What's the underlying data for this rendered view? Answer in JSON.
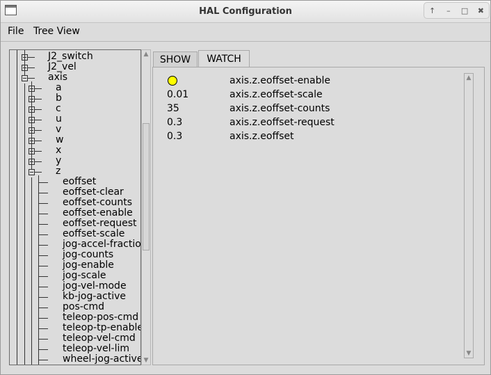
{
  "window": {
    "title": "HAL Configuration",
    "buttons": {
      "up": "↑",
      "minimize": "–",
      "maximize": "□",
      "close": "✖"
    }
  },
  "menu": {
    "file": "File",
    "tree_view": "Tree View"
  },
  "tree": {
    "top_items": [
      {
        "label": "J2_switch",
        "expander": "plus"
      },
      {
        "label": "J2_vel",
        "expander": "plus"
      },
      {
        "label": "axis",
        "expander": "minus"
      }
    ],
    "axis_children": [
      {
        "label": "a",
        "expander": "plus"
      },
      {
        "label": "b",
        "expander": "plus"
      },
      {
        "label": "c",
        "expander": "plus"
      },
      {
        "label": "u",
        "expander": "plus"
      },
      {
        "label": "v",
        "expander": "plus"
      },
      {
        "label": "w",
        "expander": "plus"
      },
      {
        "label": "x",
        "expander": "plus"
      },
      {
        "label": "y",
        "expander": "plus"
      },
      {
        "label": "z",
        "expander": "minus"
      }
    ],
    "z_children": [
      "eoffset",
      "eoffset-clear",
      "eoffset-counts",
      "eoffset-enable",
      "eoffset-request",
      "eoffset-scale",
      "jog-accel-fraction",
      "jog-counts",
      "jog-enable",
      "jog-scale",
      "jog-vel-mode",
      "kb-jog-active",
      "pos-cmd",
      "teleop-pos-cmd",
      "teleop-tp-enable",
      "teleop-vel-cmd",
      "teleop-vel-lim",
      "wheel-jog-active"
    ]
  },
  "tabs": {
    "show": "SHOW",
    "watch": "WATCH",
    "active": "watch"
  },
  "watch": {
    "led_color": "#ffff00",
    "rows": [
      {
        "value": "",
        "kind": "led",
        "name": "axis.z.eoffset-enable"
      },
      {
        "value": "0.01",
        "kind": "text",
        "name": "axis.z.eoffset-scale"
      },
      {
        "value": "35",
        "kind": "text",
        "name": "axis.z.eoffset-counts"
      },
      {
        "value": "0.3",
        "kind": "text",
        "name": "axis.z.eoffset-request"
      },
      {
        "value": "0.3",
        "kind": "text",
        "name": "axis.z.eoffset"
      }
    ]
  }
}
